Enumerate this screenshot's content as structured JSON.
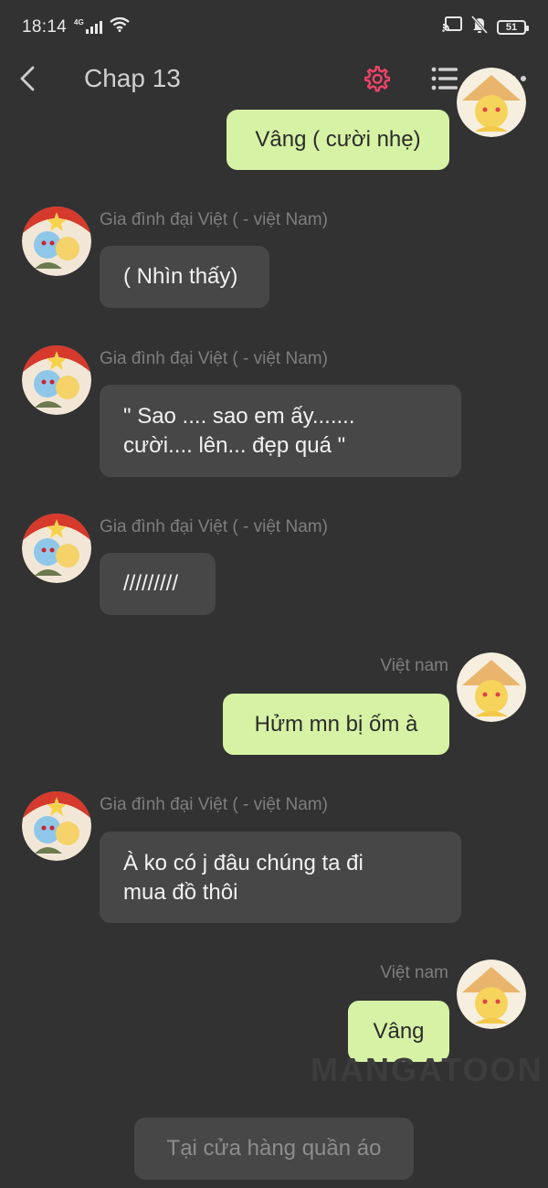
{
  "status_bar": {
    "time": "18:14",
    "network": "4G",
    "battery": "51"
  },
  "header": {
    "title": "Chap 13",
    "accent_color": "#f0436a"
  },
  "messages": [
    {
      "sender": "self",
      "name": "",
      "text": "Vâng ( cười nhẹ)"
    },
    {
      "sender": "other",
      "name": "Gia đình đại Việt ( - việt Nam)",
      "text": "( Nhìn thấy)"
    },
    {
      "sender": "other",
      "name": "Gia đình đại Việt ( - việt Nam)",
      "line1": "\" Sao .... sao em ấy.......",
      "line2": "cười.... lên... đẹp quá \""
    },
    {
      "sender": "other",
      "name": "Gia đình đại Việt ( - việt Nam)",
      "text": "/////////"
    },
    {
      "sender": "self",
      "name": "Việt nam",
      "text": "Hửm mn bị ốm à"
    },
    {
      "sender": "other",
      "name": "Gia đình đại Việt ( - việt Nam)",
      "line1": "À ko có j đâu chúng ta đi",
      "line2": "mua đồ thôi"
    },
    {
      "sender": "self",
      "name": "Việt nam",
      "text": "Vâng"
    }
  ],
  "watermark": "MANGATOON",
  "narration": "Tại cửa hàng quần áo",
  "icons": {
    "back": "back-arrow-icon",
    "settings": "gear-icon",
    "list": "list-icon",
    "more": "more-icon"
  }
}
